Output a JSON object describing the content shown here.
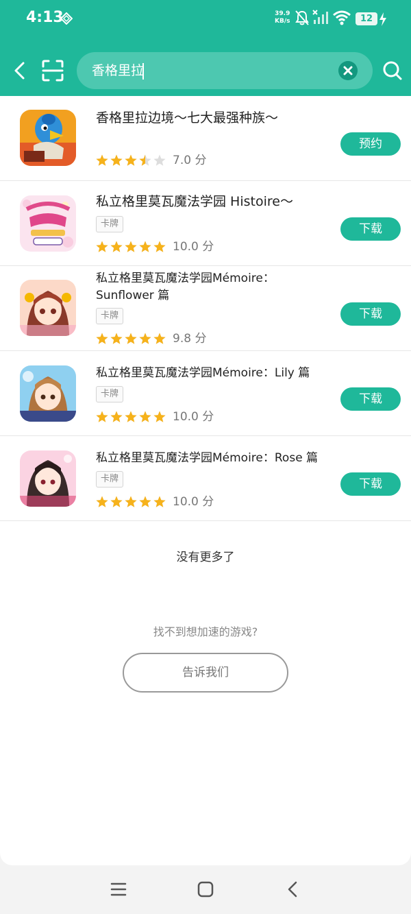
{
  "status_bar": {
    "time": "4:13",
    "net_speed_value": "39.9",
    "net_speed_unit": "KB/s",
    "battery": "12",
    "icons": [
      "vpn-diamond-icon",
      "mute-bell-icon",
      "no-signal-icon",
      "wifi-icon",
      "battery-icon",
      "charging-icon"
    ]
  },
  "search": {
    "query": "香格里拉",
    "icons": [
      "back-arrow-icon",
      "scan-icon",
      "clear-icon",
      "search-icon"
    ]
  },
  "colors": {
    "brand": "#1fb89a",
    "search_field": "#4dc8b0",
    "star": "#f6b21b",
    "star_empty": "#dddddd"
  },
  "results": [
    {
      "title": "香格里拉边境～七大最强种族～",
      "tag": "",
      "rating": 3.5,
      "score": "7.0 分",
      "action": "预约",
      "icon": "blue-bird-warrior-icon"
    },
    {
      "title": "私立格里莫瓦魔法学园 Histoire～",
      "tag": "卡牌",
      "rating": 5,
      "score": "10.0 分",
      "action": "下载",
      "icon": "histoire-logo-icon"
    },
    {
      "title": "私立格里莫瓦魔法学园Mémoire：Sunflower 篇",
      "tag": "卡牌",
      "rating": 5,
      "score": "9.8 分",
      "action": "下载",
      "icon": "anime-girl-sunflower-icon"
    },
    {
      "title": "私立格里莫瓦魔法学园Mémoire：Lily 篇",
      "tag": "卡牌",
      "rating": 5,
      "score": "10.0 分",
      "action": "下载",
      "icon": "anime-girl-lily-icon"
    },
    {
      "title": "私立格里莫瓦魔法学园Mémoire：Rose 篇",
      "tag": "卡牌",
      "rating": 5,
      "score": "10.0 分",
      "action": "下载",
      "icon": "anime-girl-rose-icon"
    }
  ],
  "footer": {
    "no_more": "没有更多了",
    "hint": "找不到想加速的游戏?",
    "tell_us": "告诉我们"
  },
  "system_nav": [
    "menu-icon",
    "home-icon",
    "back-icon"
  ]
}
